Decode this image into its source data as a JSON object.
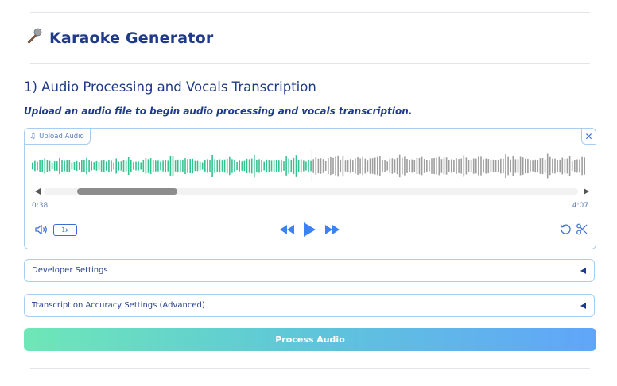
{
  "app": {
    "title": "Karaoke Generator",
    "icon": "microphone-icon"
  },
  "section": {
    "title": "1) Audio Processing and Vocals Transcription",
    "subtitle": "Upload an audio file to begin audio processing and vocals transcription."
  },
  "audio_player": {
    "upload_label": "Upload Audio",
    "current_time": "0:38",
    "duration": "4:07",
    "playback_speed": "1x",
    "played_color": "#34c38f",
    "unplayed_color": "#9e9e9e",
    "progress": 0.5
  },
  "accordions": [
    {
      "label": "Developer Settings"
    },
    {
      "label": "Transcription Accuracy Settings (Advanced)"
    }
  ],
  "process_button": {
    "label": "Process Audio"
  }
}
